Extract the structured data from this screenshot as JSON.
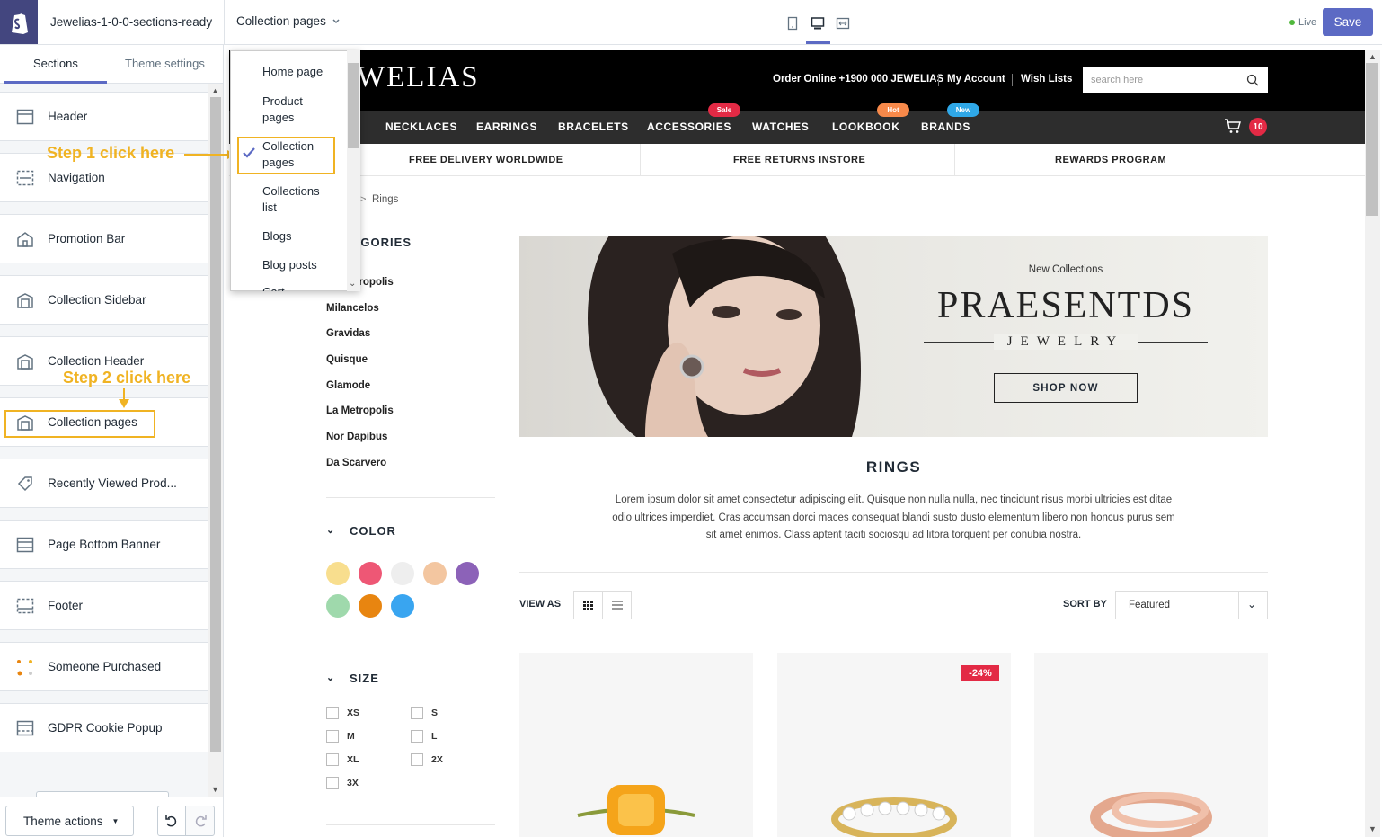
{
  "topbar": {
    "theme_name": "Jewelias-1-0-0-sections-ready",
    "page_select": "Collection pages",
    "live_label": "Live",
    "save_label": "Save"
  },
  "sidebar": {
    "tabs": [
      "Sections",
      "Theme settings"
    ],
    "sections": [
      {
        "label": "Header",
        "icon": "header-icon"
      },
      {
        "label": "Navigation",
        "icon": "navigation-icon"
      },
      {
        "label": "Promotion Bar",
        "icon": "home-icon"
      },
      {
        "label": "Collection Sidebar",
        "icon": "collection-icon"
      },
      {
        "label": "Collection Header",
        "icon": "collection-icon"
      },
      {
        "label": "Collection pages",
        "icon": "collection-icon"
      },
      {
        "label": "Recently Viewed Prod...",
        "icon": "tag-icon"
      },
      {
        "label": "Page Bottom Banner",
        "icon": "banner-icon"
      },
      {
        "label": "Footer",
        "icon": "footer-icon"
      },
      {
        "label": "Someone Purchased",
        "icon": "product-thumbnail"
      },
      {
        "label": "GDPR Cookie Popup",
        "icon": "popup-icon"
      }
    ],
    "theme_actions": "Theme actions"
  },
  "annotations": {
    "step1": "Step 1 click here",
    "step2": "Step 2 click here",
    "accent": "#f0b323"
  },
  "dropdown": {
    "items": [
      "Home page",
      "Product pages",
      "Collection pages",
      "Collections list",
      "Blogs",
      "Blog posts",
      "Cart"
    ],
    "selected": "Collection pages"
  },
  "store": {
    "logo": "JEWELIAS",
    "top_links": [
      "Order Online +1900 000 JEWELIAS",
      "My Account",
      "Wish Lists"
    ],
    "search_placeholder": "search here",
    "nav": [
      "NECKLACES",
      "EARRINGS",
      "BRACELETS",
      "ACCESSORIES",
      "WATCHES",
      "LOOKBOOK",
      "BRANDS"
    ],
    "nav_badges": [
      {
        "label": "Sale",
        "color": "#e32a45"
      },
      {
        "label": "Hot",
        "color": "#f7894a"
      },
      {
        "label": "New",
        "color": "#2fa8e8"
      }
    ],
    "cart_count": "10",
    "promo": [
      "FREE DELIVERY WORLDWIDE",
      "FREE RETURNS INSTORE",
      "REWARDS PROGRAM"
    ],
    "breadcrumb": "Rings",
    "categories_title": "CATEGORIES",
    "categories": [
      "La Metropolis",
      "Milancelos",
      "Gravidas",
      "Quisque",
      "Glamode",
      "La Metropolis",
      "Nor Dapibus",
      "Da Scarvero"
    ],
    "color_title": "COLOR",
    "colors": [
      "#f8de8e",
      "#ee5775",
      "#eeeeee",
      "#f3c6a0",
      "#8c62b8",
      "#9fd9ac",
      "#e88510",
      "#39a5f0"
    ],
    "size_title": "SIZE",
    "sizes": [
      "XS",
      "S",
      "M",
      "L",
      "XL",
      "2X",
      "3X"
    ],
    "banner": {
      "kicker": "New Collections",
      "title": "PRAESENTDS",
      "subtitle": "JEWELRY",
      "cta": "SHOP NOW"
    },
    "collection_title": "RINGS",
    "collection_desc": "Lorem ipsum dolor sit amet consectetur adipiscing elit. Quisque non nulla nulla, nec tincidunt risus morbi ultricies est ditae odio ultrices imperdiet. Cras accumsan dorci maces consequat blandi susto dusto elementum libero non honcus purus sem sit amet enimos. Class aptent taciti sociosqu ad litora torquent per conubia nostra.",
    "view_as": "VIEW AS",
    "sort_by": "SORT BY",
    "sort_value": "Featured",
    "discount_badge": "-24%"
  }
}
